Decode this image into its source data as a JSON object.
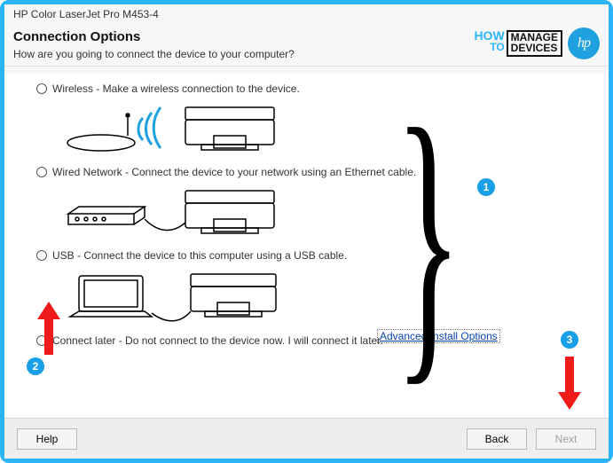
{
  "window_title": "HP Color LaserJet Pro M453-4",
  "heading": {
    "title": "Connection Options",
    "subtitle": "How are you going to connect the device to your computer?"
  },
  "options": {
    "wireless": "Wireless - Make a wireless connection to the device.",
    "wired": "Wired Network - Connect the device to your network using an Ethernet cable.",
    "usb": "USB - Connect the device to this computer using a USB cable.",
    "later": "Connect later - Do not connect to the device now. I will connect it later."
  },
  "link_text": "Advanced Install Options",
  "footer": {
    "help": "Help",
    "back": "Back",
    "next": "Next"
  },
  "logos": {
    "how": "HOW",
    "to": "TO",
    "manage": "MANAGE",
    "devices": "DEVICES",
    "hp": "hp"
  },
  "annotations": {
    "n1": "1",
    "n2": "2",
    "n3": "3"
  }
}
